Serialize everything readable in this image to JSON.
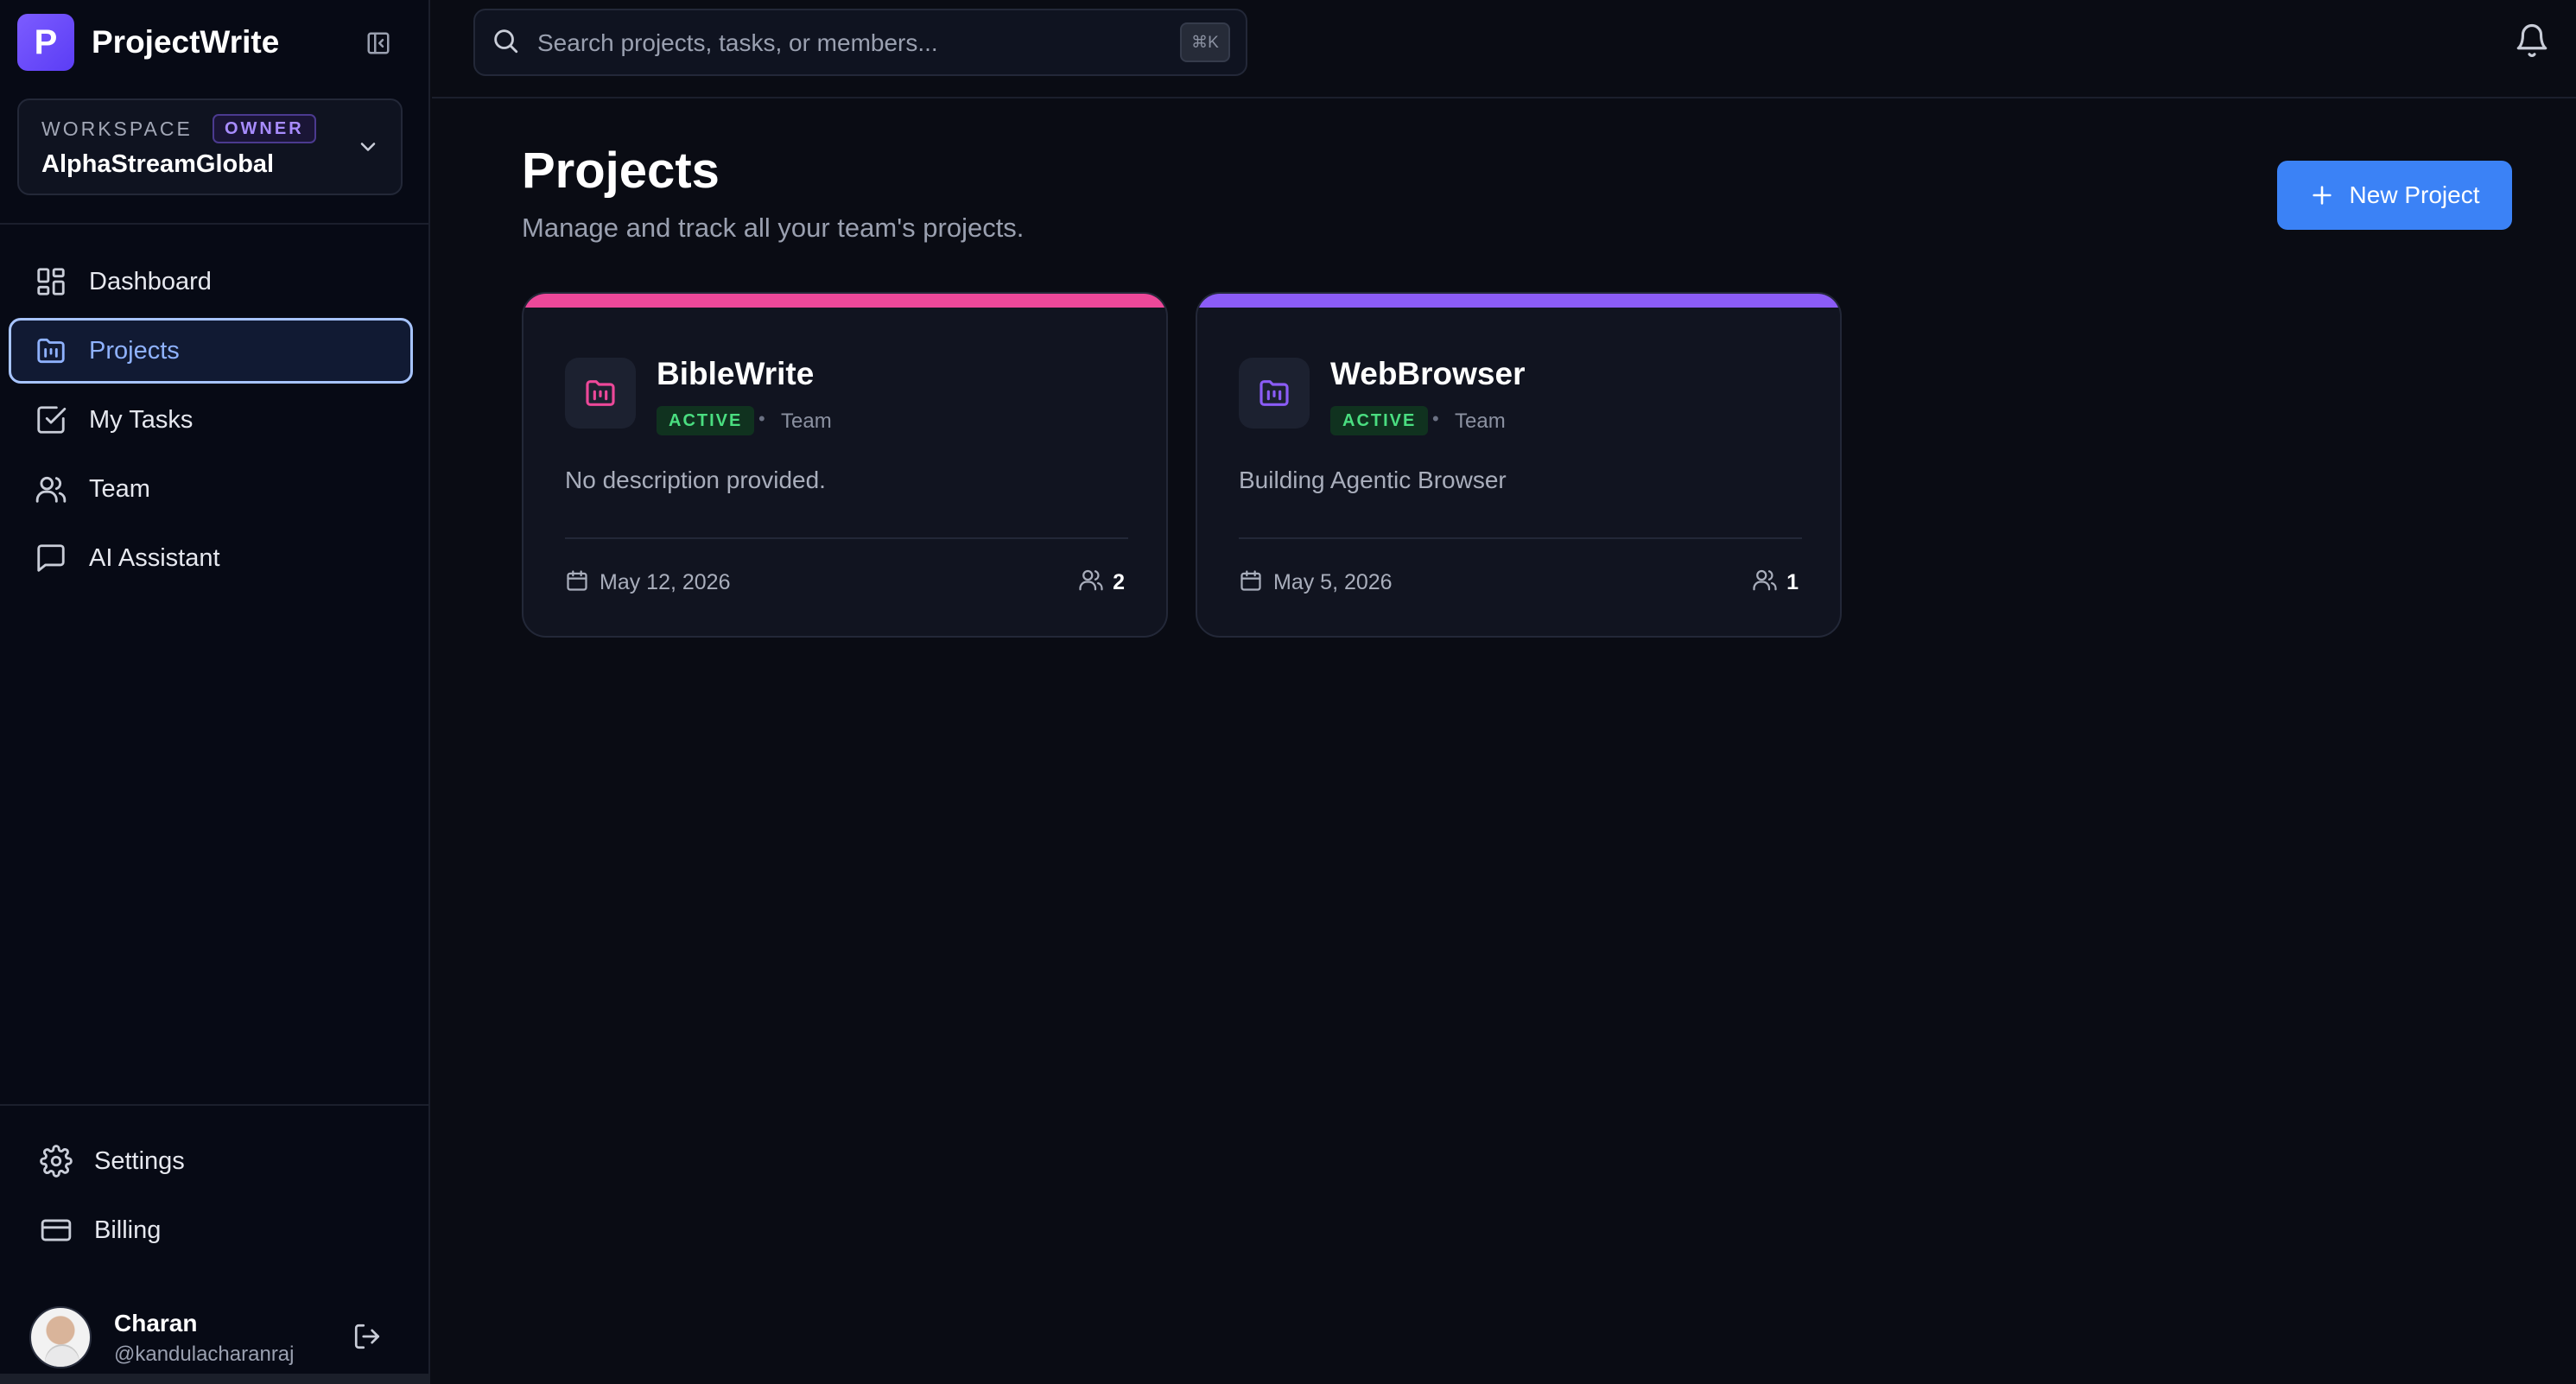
{
  "app": {
    "name": "ProjectWrite",
    "logo_letter": "P"
  },
  "workspace": {
    "label": "WORKSPACE",
    "role": "OWNER",
    "name": "AlphaStreamGlobal"
  },
  "sidebar": {
    "items": [
      {
        "label": "Dashboard",
        "icon": "dashboard-icon"
      },
      {
        "label": "Projects",
        "icon": "folder-icon",
        "active": true
      },
      {
        "label": "My Tasks",
        "icon": "check-square-icon"
      },
      {
        "label": "Team",
        "icon": "users-icon"
      },
      {
        "label": "AI Assistant",
        "icon": "chat-icon"
      }
    ],
    "bottom_items": [
      {
        "label": "Settings",
        "icon": "gear-icon"
      },
      {
        "label": "Billing",
        "icon": "credit-card-icon"
      }
    ]
  },
  "user": {
    "name": "Charan",
    "handle": "@kandulacharanraj"
  },
  "search": {
    "placeholder": "Search projects, tasks, or members...",
    "shortcut": "⌘K"
  },
  "page": {
    "title": "Projects",
    "subtitle": "Manage and track all your team's projects.",
    "new_button": "New Project"
  },
  "projects": [
    {
      "name": "BibleWrite",
      "status": "ACTIVE",
      "separator": "•",
      "type": "Team",
      "description": "No description provided.",
      "date": "May 12, 2026",
      "members": "2",
      "accent": "#ec4899"
    },
    {
      "name": "WebBrowser",
      "status": "ACTIVE",
      "separator": "•",
      "type": "Team",
      "description": "Building Agentic Browser",
      "date": "May 5, 2026",
      "members": "1",
      "accent": "#8b5cf6"
    }
  ],
  "colors": {
    "primary": "#3b82f6",
    "active_nav": "#8fb2ff",
    "status_green": "#4ade80",
    "background": "#0a0c14"
  }
}
